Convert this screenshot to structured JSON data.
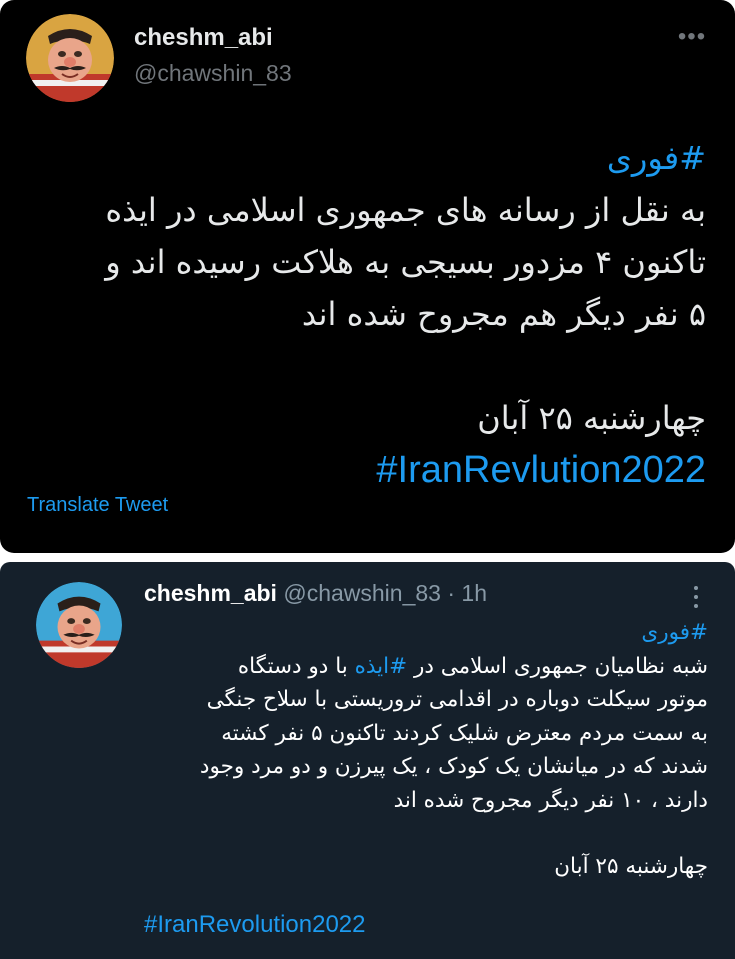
{
  "tweet_top": {
    "display_name": "cheshm_abi",
    "handle": "@chawshin_83",
    "avatar_icon": "cartoon-chef-avatar-icon",
    "more_icon": "more-horizontal-icon",
    "hashtag_line": "#فوری",
    "body_lines": [
      "به نقل از رسانه های جمهوری اسلامی در ایذه",
      "تاکنون ۴ مزدور بسیجی به هلاکت رسیده اند و",
      "۵ نفر دیگر هم مجروح شده اند"
    ],
    "date_line": "چهارشنبه ۲۵ آبان",
    "hashtag_footer": "#IranRevlution2022",
    "translate_label": "Translate Tweet",
    "colors": {
      "background": "#000000",
      "text": "#e7e9ea",
      "secondary": "#71767b",
      "link": "#1d9bf0"
    }
  },
  "tweet_bottom": {
    "display_name": "cheshm_abi",
    "handle": "@chawshin_83",
    "separator": "·",
    "time": "1h",
    "avatar_icon": "cartoon-chef-avatar-icon",
    "more_icon": "more-vertical-icon",
    "hashtag_line": "#فوری",
    "line1_prefix": "شبه نظامیان جمهوری اسلامی در ",
    "line1_hashtag": "#ایذه",
    "line1_suffix": " با دو دستگاه",
    "body_lines": [
      "موتور سیکلت دوباره در اقدامی تروریستی با سلاح جنگی",
      "به سمت مردم معترض شلیک کردند تاکنون ۵ نفر کشته",
      "شدند که در میانشان یک کودک ، یک پیرزن و دو مرد وجود",
      "دارند ، ۱۰ نفر دیگر مجروح شده اند"
    ],
    "date_line": "چهارشنبه ۲۵ آبان",
    "hashtag_footer": "#IranRevolution2022",
    "colors": {
      "background": "#15202b",
      "text": "#ffffff",
      "secondary": "#8899a6",
      "link": "#1d9bf0"
    }
  }
}
